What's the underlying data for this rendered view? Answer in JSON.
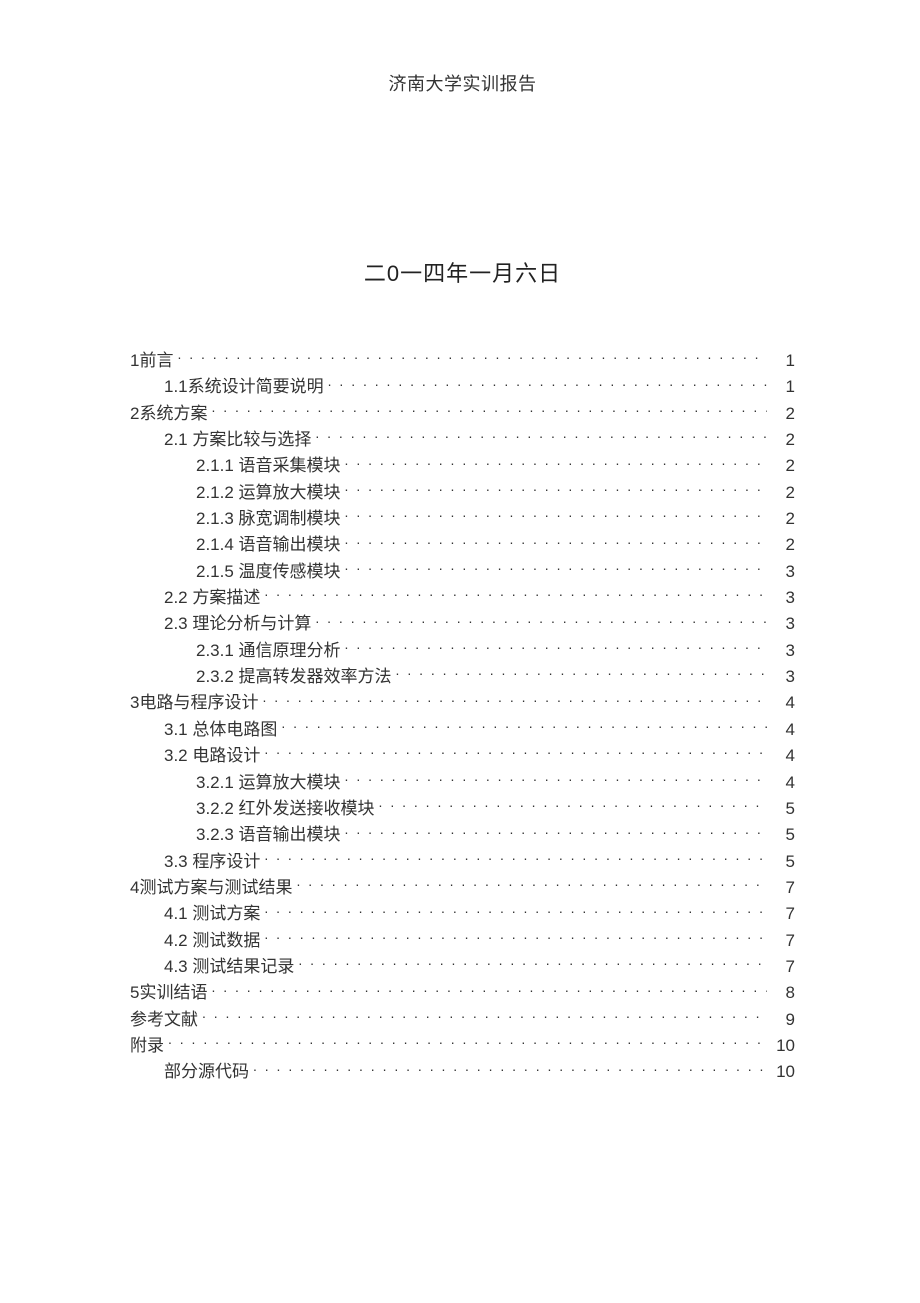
{
  "header": {
    "running_title": "济南大学实训报告",
    "date_line": "二0一四年一月六日"
  },
  "toc": {
    "entries": [
      {
        "level": 0,
        "label": "1前言",
        "page": "1"
      },
      {
        "level": 1,
        "label": "1.1系统设计简要说明",
        "page": "1"
      },
      {
        "level": 0,
        "label": "2系统方案",
        "page": "2"
      },
      {
        "level": 1,
        "label": "2.1  方案比较与选择",
        "page": "2"
      },
      {
        "level": 2,
        "label": "2.1.1    语音采集模块",
        "page": "2"
      },
      {
        "level": 2,
        "label": "2.1.2    运算放大模块",
        "page": "2"
      },
      {
        "level": 2,
        "label": "2.1.3    脉宽调制模块",
        "page": "2"
      },
      {
        "level": 2,
        "label": "2.1.4    语音输出模块",
        "page": "2"
      },
      {
        "level": 2,
        "label": "2.1.5    温度传感模块",
        "page": "3"
      },
      {
        "level": 1,
        "label": "2.2  方案描述",
        "page": "3"
      },
      {
        "level": 1,
        "label": "2.3  理论分析与计算",
        "page": "3"
      },
      {
        "level": 2,
        "label": "2.3.1    通信原理分析",
        "page": "3"
      },
      {
        "level": 2,
        "label": "2.3.2    提高转发器效率方法",
        "page": "3"
      },
      {
        "level": 0,
        "label": "3电路与程序设计",
        "page": "4"
      },
      {
        "level": 1,
        "label": "3.1  总体电路图",
        "page": "4"
      },
      {
        "level": 1,
        "label": "3.2  电路设计",
        "page": "4"
      },
      {
        "level": 2,
        "label": "3.2.1    运算放大模块",
        "page": "4"
      },
      {
        "level": 2,
        "label": "3.2.2    红外发送接收模块",
        "page": "5"
      },
      {
        "level": 2,
        "label": "3.2.3    语音输出模块",
        "page": "5"
      },
      {
        "level": 1,
        "label": "3.3  程序设计",
        "page": "5"
      },
      {
        "level": 0,
        "label": "4测试方案与测试结果",
        "page": "7"
      },
      {
        "level": 1,
        "label": "4.1  测试方案",
        "page": "7"
      },
      {
        "level": 1,
        "label": "4.2  测试数据",
        "page": "7"
      },
      {
        "level": 1,
        "label": "4.3  测试结果记录",
        "page": "7"
      },
      {
        "level": 0,
        "label": "5实训结语",
        "page": "8"
      },
      {
        "level": 0,
        "label": "参考文献",
        "page": "9"
      },
      {
        "level": 0,
        "label": "附录",
        "page": "10"
      },
      {
        "level": 1,
        "label": "部分源代码",
        "page": "10"
      }
    ]
  }
}
